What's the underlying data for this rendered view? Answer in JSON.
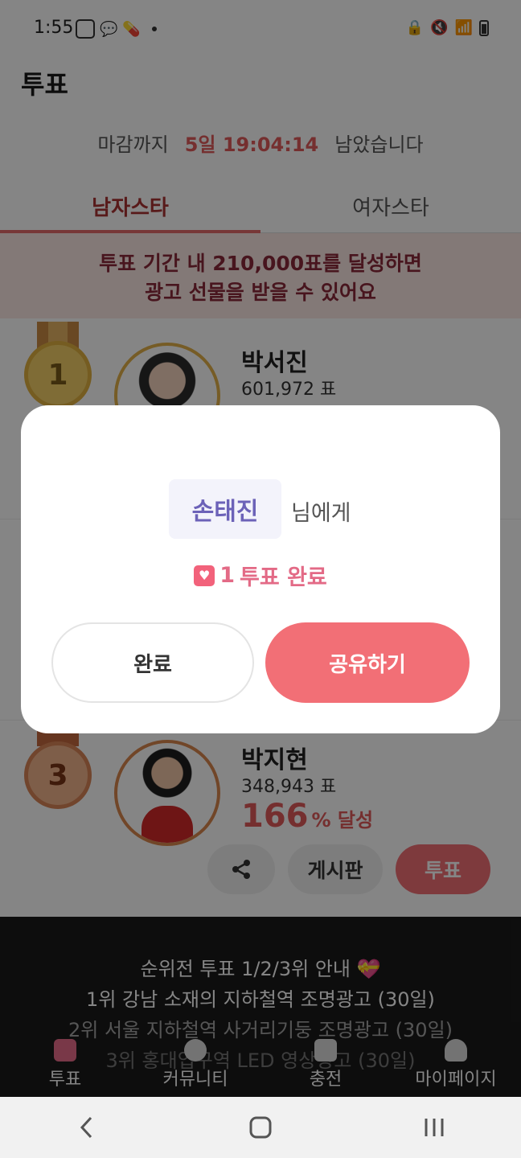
{
  "status_bar": {
    "time": "1:55"
  },
  "header": {
    "title": "투표"
  },
  "deadline": {
    "prefix": "마감까지",
    "countdown": "5일 19:04:14",
    "suffix": "남았습니다"
  },
  "tabs": [
    {
      "label": "남자스타",
      "active": true
    },
    {
      "label": "여자스타",
      "active": false
    }
  ],
  "goal_banner": {
    "line1": "투표 기간 내 210,000표를 달성하면",
    "line2": "광고 선물을 받을 수 있어요"
  },
  "ranking": [
    {
      "rank": "1",
      "name": "박서진",
      "votes": "601,972 표"
    },
    {
      "rank": "3",
      "name": "박지현",
      "votes": "348,943 표",
      "achievement": "166",
      "achievement_unit": "% 달성"
    }
  ],
  "item_actions": {
    "board_label": "게시판",
    "vote_label": "투표"
  },
  "notice": {
    "title": "순위전 투표 1/2/3위 안내 💝",
    "line1": "1위 강남 소재의 지하철역 조명광고 (30일)",
    "line2": "2위 서울 지하철역 사거리기둥 조명광고 (30일)",
    "line3": "3위 홍대입구역 LED 영상광고 (30일)"
  },
  "bottom_nav": [
    {
      "label": "투표",
      "icon": "heart-card-icon",
      "active": true
    },
    {
      "label": "커뮤니티",
      "icon": "chat-bubbles-icon",
      "active": false
    },
    {
      "label": "충전",
      "icon": "shirt-icon",
      "active": false
    },
    {
      "label": "마이페이지",
      "icon": "person-icon",
      "active": false
    }
  ],
  "modal": {
    "recipient": "손태진",
    "recipient_suffix": "님에게",
    "vote_count": "1",
    "vote_done_text": "투표 완료",
    "done_button": "완료",
    "share_button": "공유하기"
  },
  "colors": {
    "accent": "#f26f76",
    "countdown": "#e05a5a",
    "recipient": "#6c62b8",
    "vote_done": "#e36a86"
  }
}
